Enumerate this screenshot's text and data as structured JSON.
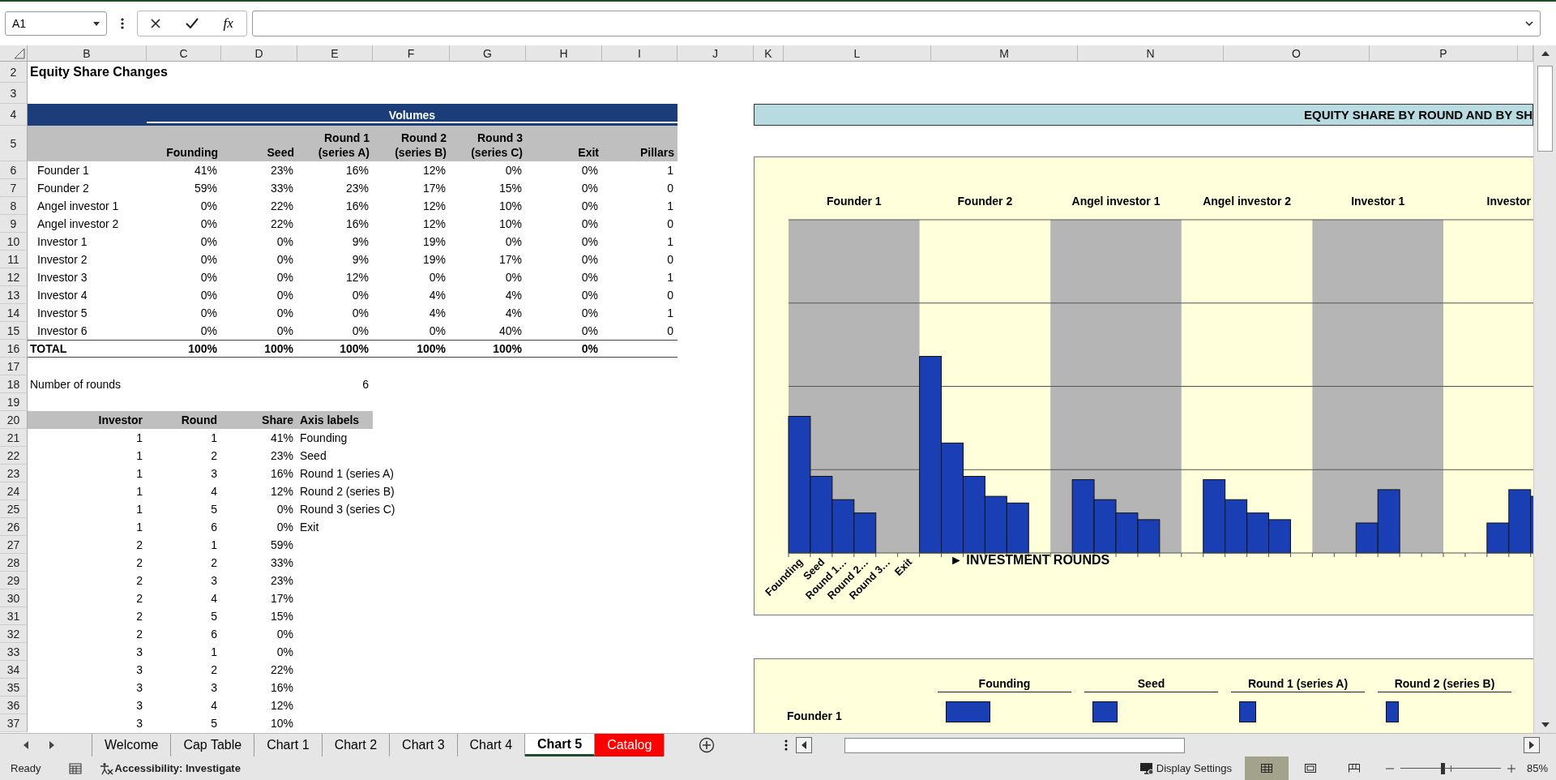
{
  "name_box": {
    "value": "A1"
  },
  "formula_bar": {
    "function_label": "fx"
  },
  "column_headers": [
    "B",
    "C",
    "D",
    "E",
    "F",
    "G",
    "H",
    "I",
    "J",
    "K",
    "L",
    "M",
    "N",
    "O",
    "P"
  ],
  "row_headers": [
    "2",
    "3",
    "4",
    "5",
    "6",
    "7",
    "8",
    "9",
    "10",
    "11",
    "12",
    "13",
    "14",
    "15",
    "16",
    "17",
    "18",
    "19",
    "20",
    "21",
    "22",
    "23",
    "24",
    "25",
    "26",
    "27",
    "28",
    "29",
    "30",
    "31",
    "32",
    "33",
    "34",
    "35",
    "36",
    "37"
  ],
  "sheet": {
    "title": "Equity Share Changes",
    "group_header": "Volumes",
    "volumes_table": {
      "columns": [
        {
          "lines": [
            "Founding"
          ]
        },
        {
          "lines": [
            "Seed"
          ]
        },
        {
          "lines": [
            "Round 1",
            "(series A)"
          ]
        },
        {
          "lines": [
            "Round 2",
            "(series B)"
          ]
        },
        {
          "lines": [
            "Round 3",
            "(series C)"
          ]
        },
        {
          "lines": [
            "Exit"
          ]
        },
        {
          "lines": [
            "Pillars"
          ]
        }
      ],
      "rows": [
        {
          "name": "Founder 1",
          "values": [
            "41%",
            "23%",
            "16%",
            "12%",
            "0%",
            "0%"
          ],
          "pillars": "1"
        },
        {
          "name": "Founder 2",
          "values": [
            "59%",
            "33%",
            "23%",
            "17%",
            "15%",
            "0%"
          ],
          "pillars": "0"
        },
        {
          "name": "Angel investor 1",
          "values": [
            "0%",
            "22%",
            "16%",
            "12%",
            "10%",
            "0%"
          ],
          "pillars": "1"
        },
        {
          "name": "Angel investor 2",
          "values": [
            "0%",
            "22%",
            "16%",
            "12%",
            "10%",
            "0%"
          ],
          "pillars": "0"
        },
        {
          "name": "Investor 1",
          "values": [
            "0%",
            "0%",
            "9%",
            "19%",
            "0%",
            "0%"
          ],
          "pillars": "1"
        },
        {
          "name": "Investor 2",
          "values": [
            "0%",
            "0%",
            "9%",
            "19%",
            "17%",
            "0%"
          ],
          "pillars": "0"
        },
        {
          "name": "Investor 3",
          "values": [
            "0%",
            "0%",
            "12%",
            "0%",
            "0%",
            "0%"
          ],
          "pillars": "1"
        },
        {
          "name": "Investor 4",
          "values": [
            "0%",
            "0%",
            "0%",
            "4%",
            "4%",
            "0%"
          ],
          "pillars": "0"
        },
        {
          "name": "Investor 5",
          "values": [
            "0%",
            "0%",
            "0%",
            "4%",
            "4%",
            "0%"
          ],
          "pillars": "1"
        },
        {
          "name": "Investor 6",
          "values": [
            "0%",
            "0%",
            "0%",
            "0%",
            "40%",
            "0%"
          ],
          "pillars": "0"
        }
      ],
      "total": {
        "label": "TOTAL",
        "values": [
          "100%",
          "100%",
          "100%",
          "100%",
          "100%",
          "0%"
        ]
      }
    },
    "rounds": {
      "label": "Number of rounds",
      "value": "6"
    },
    "axis_table": {
      "columns": [
        "Investor",
        "Round",
        "Share",
        "Axis labels"
      ],
      "rows": [
        {
          "investor": "1",
          "round": "1",
          "share": "41%",
          "axis_label": "Founding"
        },
        {
          "investor": "1",
          "round": "2",
          "share": "23%",
          "axis_label": "Seed"
        },
        {
          "investor": "1",
          "round": "3",
          "share": "16%",
          "axis_label": "Round 1 (series A)"
        },
        {
          "investor": "1",
          "round": "4",
          "share": "12%",
          "axis_label": "Round 2 (series B)"
        },
        {
          "investor": "1",
          "round": "5",
          "share": "0%",
          "axis_label": "Round 3 (series C)"
        },
        {
          "investor": "1",
          "round": "6",
          "share": "0%",
          "axis_label": "Exit"
        },
        {
          "investor": "2",
          "round": "1",
          "share": "59%"
        },
        {
          "investor": "2",
          "round": "2",
          "share": "33%"
        },
        {
          "investor": "2",
          "round": "3",
          "share": "23%"
        },
        {
          "investor": "2",
          "round": "4",
          "share": "17%"
        },
        {
          "investor": "2",
          "round": "5",
          "share": "15%"
        },
        {
          "investor": "2",
          "round": "6",
          "share": "0%"
        },
        {
          "investor": "3",
          "round": "1",
          "share": "0%"
        },
        {
          "investor": "3",
          "round": "2",
          "share": "22%"
        },
        {
          "investor": "3",
          "round": "3",
          "share": "16%"
        },
        {
          "investor": "3",
          "round": "4",
          "share": "12%"
        },
        {
          "investor": "3",
          "round": "5",
          "share": "10%"
        }
      ]
    }
  },
  "banner": {
    "title": "EQUITY SHARE BY ROUND AND BY SH"
  },
  "chart_by_investor": {
    "groups": [
      "Founder 1",
      "Founder 2",
      "Angel investor 1",
      "Angel investor 2",
      "Investor 1",
      "Investor"
    ],
    "axis_labels": [
      "Founding",
      "Seed",
      "Round 1…",
      "Round 2…",
      "Round 3…",
      "Exit"
    ],
    "axis_title": "► INVESTMENT ROUNDS"
  },
  "chart_by_round": {
    "columns": [
      "Founding",
      "Seed",
      "Round 1 (series A)",
      "Round 2 (series B)"
    ],
    "rows": [
      "Founder 1"
    ]
  },
  "sheet_tabs": [
    {
      "label": "Welcome",
      "selected": false
    },
    {
      "label": "Cap Table",
      "selected": false
    },
    {
      "label": "Chart 1",
      "selected": false
    },
    {
      "label": "Chart 2",
      "selected": false
    },
    {
      "label": "Chart 3",
      "selected": false
    },
    {
      "label": "Chart 4",
      "selected": false
    },
    {
      "label": "Chart 5",
      "selected": true
    },
    {
      "label": "Catalog",
      "selected": false,
      "color": "#ff0000"
    }
  ],
  "status_bar": {
    "mode": "Ready",
    "accessibility": "Accessibility: Investigate",
    "display_settings": "Display Settings",
    "views": [
      {
        "kind": "normal",
        "selected": true
      },
      {
        "kind": "page_layout",
        "selected": false
      },
      {
        "kind": "page_break",
        "selected": false
      }
    ],
    "zoom": {
      "level": 0.42,
      "reading": "85%"
    }
  }
}
